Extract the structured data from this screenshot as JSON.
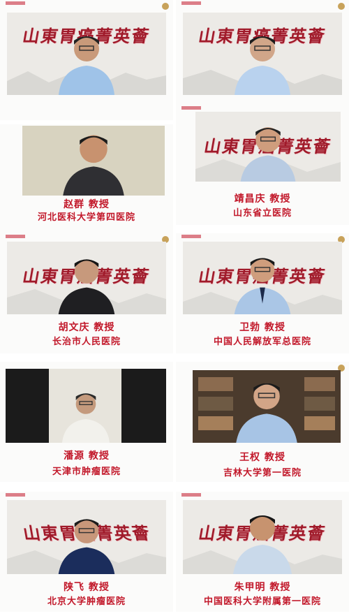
{
  "banner_text": "山東胃癌菁英薈",
  "participants": [
    {
      "name": "",
      "hospital": ""
    },
    {
      "name": "",
      "hospital": ""
    },
    {
      "name": "赵群 教授",
      "hospital": "河北医科大学第四医院"
    },
    {
      "name": "靖昌庆 教授",
      "hospital": "山东省立医院"
    },
    {
      "name": "胡文庆 教授",
      "hospital": "长治市人民医院"
    },
    {
      "name": "卫勃 教授",
      "hospital": "中国人民解放军总医院"
    },
    {
      "name": "潘源 教授",
      "hospital": "天津市肿瘤医院"
    },
    {
      "name": "王权 教授",
      "hospital": "吉林大学第一医院"
    },
    {
      "name": "陕飞 教授",
      "hospital": "北京大学肿瘤医院"
    },
    {
      "name": "朱甲明 教授",
      "hospital": "中国医科大学附属第一医院"
    }
  ],
  "colors": {
    "accent": "#c2182a",
    "banner": "#a01a2a"
  }
}
